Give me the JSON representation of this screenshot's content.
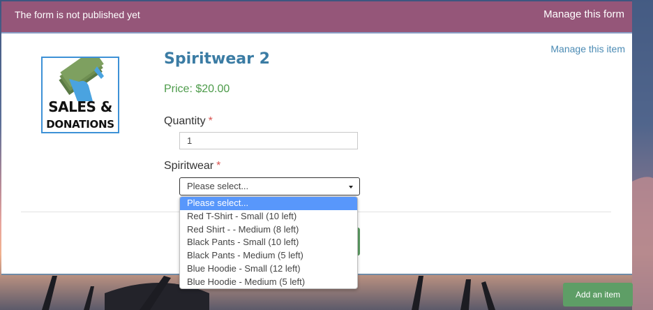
{
  "topbar": {
    "status": "The form is not published yet",
    "manage_form": "Manage this form"
  },
  "item": {
    "manage_item": "Manage this item",
    "logo_line1": "SALES &",
    "logo_line2": "DONATIONS",
    "title": "Spiritwear 2",
    "price": "Price: $20.00"
  },
  "form": {
    "quantity_label": "Quantity",
    "quantity_value": "1",
    "spiritwear_label": "Spiritwear",
    "required_mark": "*",
    "select_value": "Please select...",
    "options": [
      "Please select...",
      "Red T-Shirt - Small (10 left)",
      "Red Shirt - - Medium (8 left)",
      "Black Pants - Small (10 left)",
      "Black Pants - Medium (5 left)",
      "Blue Hoodie - Small (12 left)",
      "Blue Hoodie - Medium (5 left)"
    ]
  },
  "actions": {
    "add_item": "Add an item"
  },
  "colors": {
    "topbar": "#955679",
    "title": "#3b7ca4",
    "price": "#4d9b4a",
    "option_highlight": "#5897fb",
    "add_button": "#5e9e66"
  }
}
